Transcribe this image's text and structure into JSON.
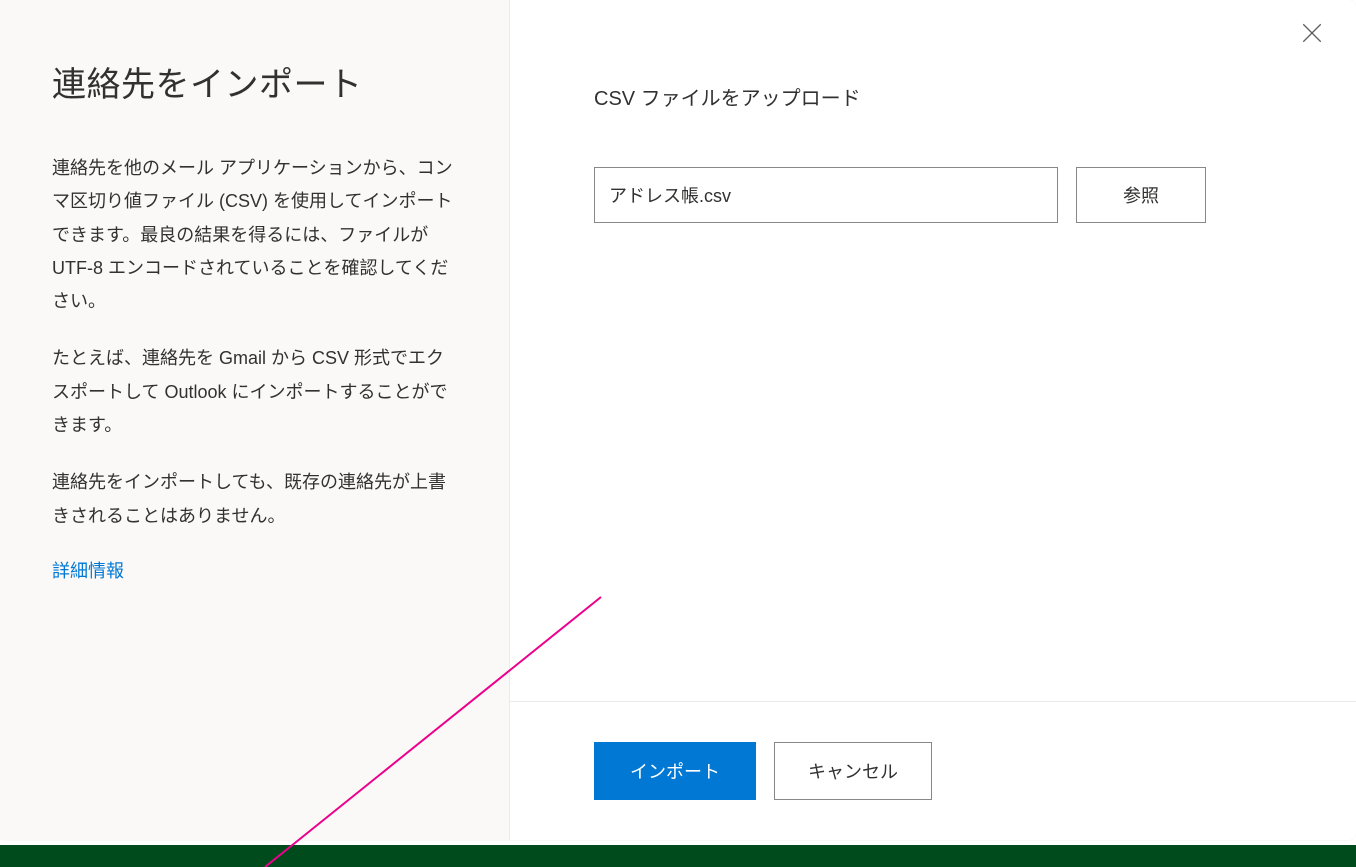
{
  "leftPanel": {
    "title": "連絡先をインポート",
    "paragraph1": "連絡先を他のメール アプリケーションから、コンマ区切り値ファイル (CSV) を使用してインポートできます。最良の結果を得るには、ファイルが UTF-8 エンコードされていることを確認してください。",
    "paragraph2": "たとえば、連絡先を Gmail から CSV 形式でエクスポートして Outlook にインポートすることができます。",
    "paragraph3": "連絡先をインポートしても、既存の連絡先が上書きされることはありません。",
    "moreInfoLabel": "詳細情報"
  },
  "rightPanel": {
    "sectionTitle": "CSV ファイルをアップロード",
    "fileValue": "アドレス帳.csv",
    "browseLabel": "参照"
  },
  "footer": {
    "importLabel": "インポート",
    "cancelLabel": "キャンセル"
  },
  "colors": {
    "primary": "#0078d4",
    "annotation": "#ec008c"
  }
}
